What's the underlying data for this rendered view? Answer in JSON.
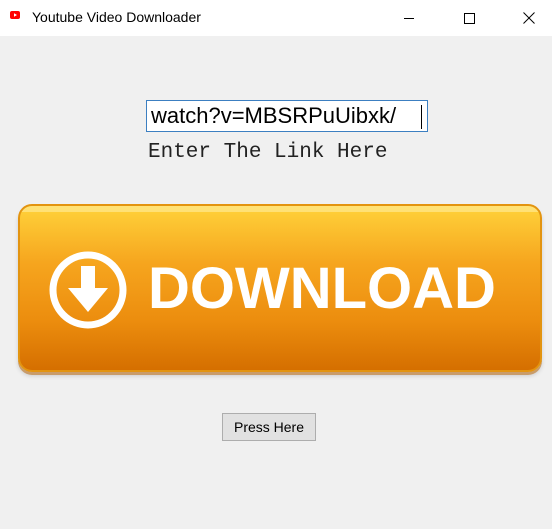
{
  "window": {
    "title": "Youtube Video Downloader",
    "icon": "youtube-icon",
    "controls": [
      "minimize-icon",
      "maximize-icon",
      "close-icon"
    ]
  },
  "link_input": {
    "value": "/watch?v=MBSRPuUibxk"
  },
  "hint_label": "Enter The Link Here",
  "download_banner": {
    "label": "DOWNLOAD",
    "icon": "download-arrow-icon",
    "colors": {
      "top": "#ffd23a",
      "bottom": "#d56f00"
    }
  },
  "press_button": {
    "label": "Press Here"
  }
}
